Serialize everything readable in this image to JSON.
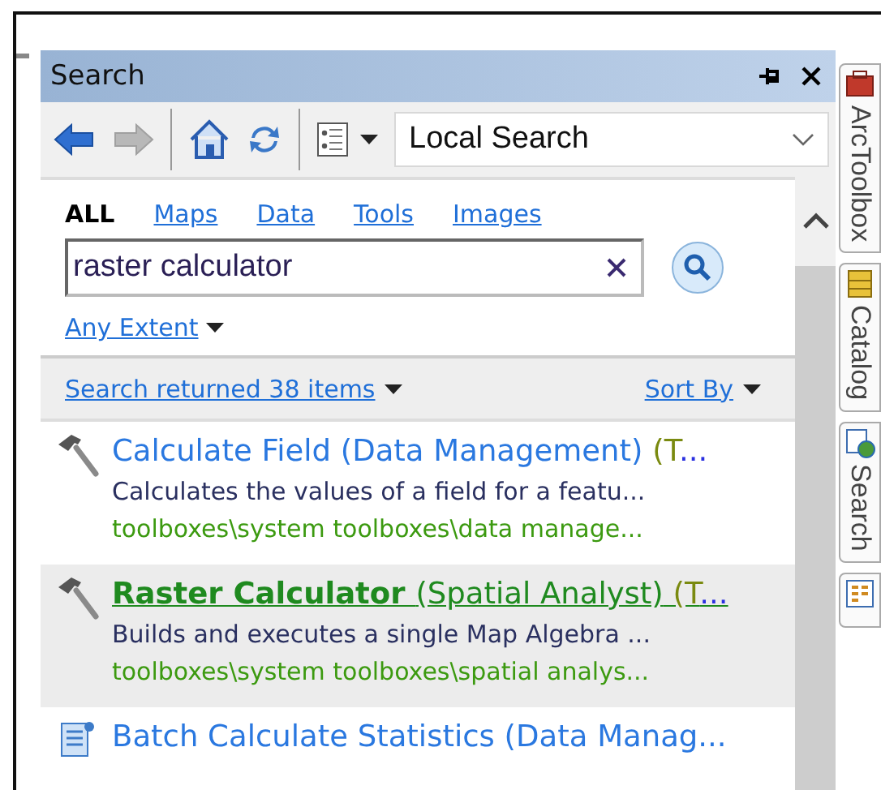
{
  "panel": {
    "title": "Search"
  },
  "toolbar": {
    "scope": {
      "value": "Local Search"
    }
  },
  "scope_tabs": [
    {
      "label": "ALL",
      "selected": true
    },
    {
      "label": "Maps",
      "selected": false
    },
    {
      "label": "Data",
      "selected": false
    },
    {
      "label": "Tools",
      "selected": false
    },
    {
      "label": "Images",
      "selected": false
    }
  ],
  "search": {
    "value": "raster calculator"
  },
  "extent": "Any Extent",
  "summary": "Search returned 38 items",
  "sort": "Sort By",
  "results": [
    {
      "kind": "tool",
      "selected": false,
      "name": "Calculate Field",
      "category": "(Data Management)",
      "type_hint": "(T",
      "ellipsis": "...",
      "description": "Calculates the values of a field for a featu...",
      "path": "toolboxes\\system toolboxes\\data manage..."
    },
    {
      "kind": "tool",
      "selected": true,
      "name": "Raster Calculator",
      "category": "(Spatial Analyst)",
      "type_hint": "(T",
      "ellipsis": "...",
      "description": "Builds and executes a single Map Algebra ...",
      "path": "toolboxes\\system toolboxes\\spatial analys..."
    },
    {
      "kind": "batch",
      "selected": false,
      "name": "Batch Calculate Statistics",
      "category": "(Data Manag..."
    }
  ],
  "side_tabs": [
    {
      "kind": "toolbox",
      "label": "ArcToolbox"
    },
    {
      "kind": "catalog",
      "label": "Catalog"
    },
    {
      "kind": "search",
      "label": "Search"
    },
    {
      "kind": "form"
    }
  ]
}
